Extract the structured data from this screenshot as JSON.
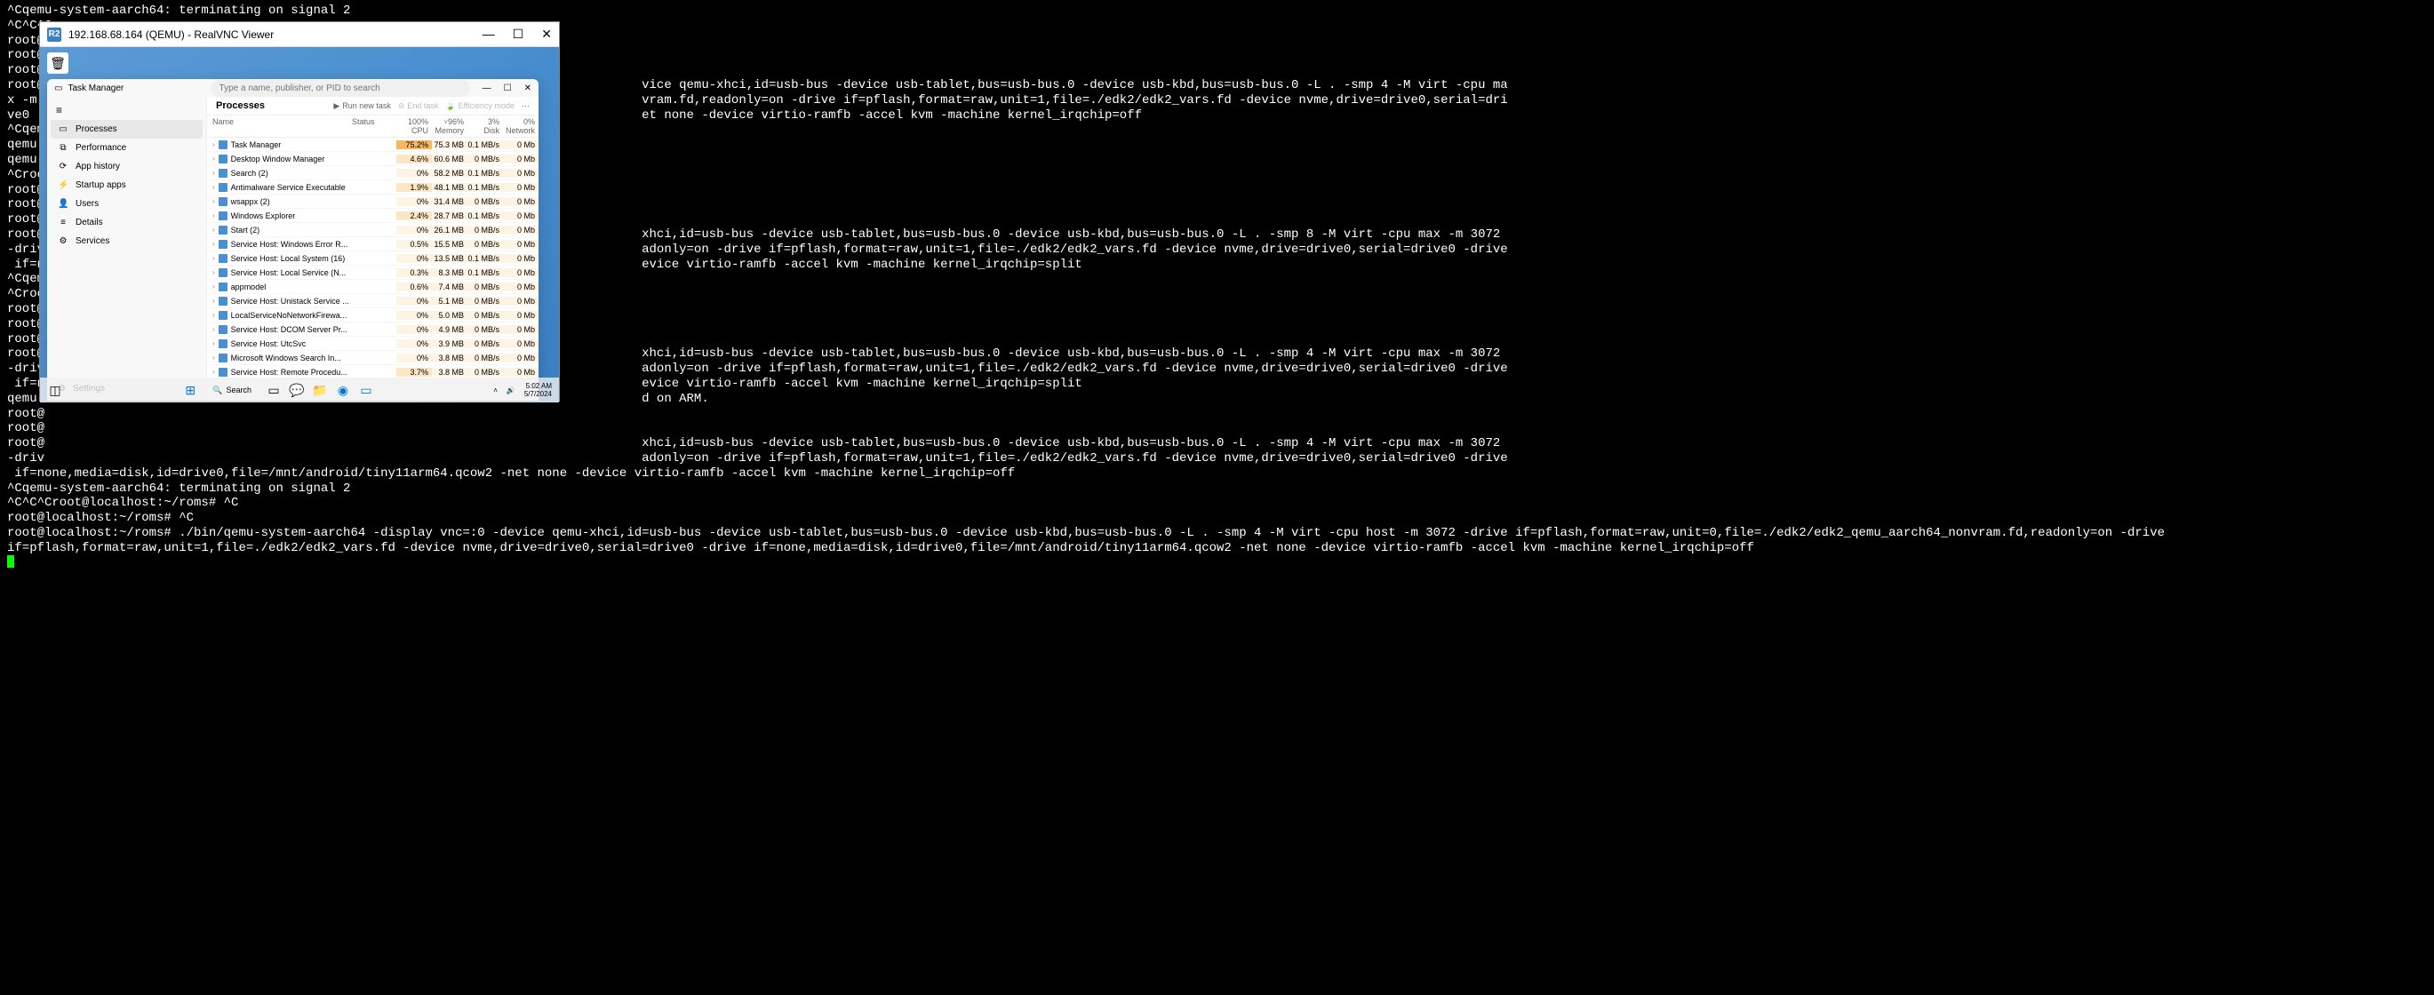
{
  "terminal_lines": [
    "^Cqemu-system-aarch64: terminating on signal 2",
    "^C^C^C",
    "root@",
    "root@",
    "root@",
    "root@                                                                                vice qemu-xhci,id=usb-bus -device usb-tablet,bus=usb-bus.0 -device usb-kbd,bus=usb-bus.0 -L . -smp 4 -M virt -cpu ma",
    "x -m                                                                                 vram.fd,readonly=on -drive if=pflash,format=raw,unit=1,file=./edk2/edk2_vars.fd -device nvme,drive=drive0,serial=dri",
    "ve0 -                                                                                et none -device virtio-ramfb -accel kvm -machine kernel_irqchip=off",
    "^Cqemu",
    "qemu-",
    "qemu-",
    "^Croot@",
    "root@",
    "root@",
    "root@",
    "root@                                                                                xhci,id=usb-bus -device usb-tablet,bus=usb-bus.0 -device usb-kbd,bus=usb-bus.0 -L . -smp 8 -M virt -cpu max -m 3072",
    "-driv                                                                                adonly=on -drive if=pflash,format=raw,unit=1,file=./edk2/edk2_vars.fd -device nvme,drive=drive0,serial=drive0 -drive",
    " if=n                                                                                evice virtio-ramfb -accel kvm -machine kernel_irqchip=split",
    "^Cqemu",
    "^Croot@",
    "root@",
    "root@",
    "root@",
    "root@                                                                                xhci,id=usb-bus -device usb-tablet,bus=usb-bus.0 -device usb-kbd,bus=usb-bus.0 -L . -smp 4 -M virt -cpu max -m 3072",
    "-driv                                                                                adonly=on -drive if=pflash,format=raw,unit=1,file=./edk2/edk2_vars.fd -device nvme,drive=drive0,serial=drive0 -drive",
    " if=n                                                                                evice virtio-ramfb -accel kvm -machine kernel_irqchip=split",
    "qemu-                                                                                d on ARM.",
    "root@",
    "root@",
    "root@                                                                                xhci,id=usb-bus -device usb-tablet,bus=usb-bus.0 -device usb-kbd,bus=usb-bus.0 -L . -smp 4 -M virt -cpu max -m 3072",
    "-driv                                                                                adonly=on -drive if=pflash,format=raw,unit=1,file=./edk2/edk2_vars.fd -device nvme,drive=drive0,serial=drive0 -drive",
    " if=none,media=disk,id=drive0,file=/mnt/android/tiny11arm64.qcow2 -net none -device virtio-ramfb -accel kvm -machine kernel_irqchip=off",
    "^Cqemu-system-aarch64: terminating on signal 2",
    "^C^C^Croot@localhost:~/roms# ^C",
    "root@localhost:~/roms# ^C",
    "root@localhost:~/roms# ./bin/qemu-system-aarch64 -display vnc=:0 -device qemu-xhci,id=usb-bus -device usb-tablet,bus=usb-bus.0 -device usb-kbd,bus=usb-bus.0 -L . -smp 4 -M virt -cpu host -m 3072 -drive if=pflash,format=raw,unit=0,file=./edk2/edk2_qemu_aarch64_nonvram.fd,readonly=on -drive if=pflash,format=raw,unit=1,file=./edk2/edk2_vars.fd -device nvme,drive=drive0,serial=drive0 -drive if=none,media=disk,id=drive0,file=/mnt/android/tiny11arm64.qcow2 -net none -device virtio-ramfb -accel kvm -machine kernel_irqchip=off"
  ],
  "vnc": {
    "icon_text": "R2",
    "title": "192.168.68.164 (QEMU) - RealVNC Viewer",
    "minimize": "—",
    "maximize": "☐",
    "close": "✕"
  },
  "taskmgr": {
    "title": "Task Manager",
    "search_placeholder": "Type a name, publisher, or PID to search",
    "nav": [
      {
        "icon": "▭",
        "label": "Processes"
      },
      {
        "icon": "⧉",
        "label": "Performance"
      },
      {
        "icon": "⟳",
        "label": "App history"
      },
      {
        "icon": "⚡",
        "label": "Startup apps"
      },
      {
        "icon": "👤",
        "label": "Users"
      },
      {
        "icon": "≡",
        "label": "Details"
      },
      {
        "icon": "⚙",
        "label": "Services"
      }
    ],
    "settings": "Settings",
    "proc_header": "Processes",
    "actions": {
      "run": "Run new task",
      "end": "End task",
      "eff": "Efficiency mode"
    },
    "cols": {
      "name": "Name",
      "status": "Status",
      "cpu_pct": "100%",
      "cpu": "CPU",
      "mem_pct": "96%",
      "mem": "Memory",
      "disk_pct": "3%",
      "disk": "Disk",
      "net_pct": "0%",
      "net": "Network"
    },
    "rows": [
      {
        "name": "Task Manager",
        "cpu": "75.2%",
        "mem": "75.3 MB",
        "disk": "0.1 MB/s",
        "net": "0 Mb",
        "cpu_heat": "heat-high"
      },
      {
        "name": "Desktop Window Manager",
        "cpu": "4.6%",
        "mem": "60.6 MB",
        "disk": "0 MB/s",
        "net": "0 Mb",
        "cpu_heat": "heat-med"
      },
      {
        "name": "Search (2)",
        "cpu": "0%",
        "mem": "58.2 MB",
        "disk": "0.1 MB/s",
        "net": "0 Mb",
        "cpu_heat": "heat-low"
      },
      {
        "name": "Antimalware Service Executable",
        "cpu": "1.9%",
        "mem": "48.1 MB",
        "disk": "0.1 MB/s",
        "net": "0 Mb",
        "cpu_heat": "heat-med"
      },
      {
        "name": "wsappx (2)",
        "cpu": "0%",
        "mem": "31.4 MB",
        "disk": "0 MB/s",
        "net": "0 Mb",
        "cpu_heat": "heat-low"
      },
      {
        "name": "Windows Explorer",
        "cpu": "2.4%",
        "mem": "28.7 MB",
        "disk": "0.1 MB/s",
        "net": "0 Mb",
        "cpu_heat": "heat-med"
      },
      {
        "name": "Start (2)",
        "cpu": "0%",
        "mem": "26.1 MB",
        "disk": "0 MB/s",
        "net": "0 Mb",
        "cpu_heat": "heat-low"
      },
      {
        "name": "Service Host: Windows Error R...",
        "cpu": "0.5%",
        "mem": "15.5 MB",
        "disk": "0 MB/s",
        "net": "0 Mb",
        "cpu_heat": "heat-low"
      },
      {
        "name": "Service Host: Local System (16)",
        "cpu": "0%",
        "mem": "13.5 MB",
        "disk": "0.1 MB/s",
        "net": "0 Mb",
        "cpu_heat": "heat-low"
      },
      {
        "name": "Service Host: Local Service (N...",
        "cpu": "0.3%",
        "mem": "8.3 MB",
        "disk": "0.1 MB/s",
        "net": "0 Mb",
        "cpu_heat": "heat-low"
      },
      {
        "name": "appmodel",
        "cpu": "0.6%",
        "mem": "7.4 MB",
        "disk": "0 MB/s",
        "net": "0 Mb",
        "cpu_heat": "heat-low"
      },
      {
        "name": "Service Host: Unistack Service ...",
        "cpu": "0%",
        "mem": "5.1 MB",
        "disk": "0 MB/s",
        "net": "0 Mb",
        "cpu_heat": "heat-low"
      },
      {
        "name": "LocalServiceNoNetworkFirewa...",
        "cpu": "0%",
        "mem": "5.0 MB",
        "disk": "0 MB/s",
        "net": "0 Mb",
        "cpu_heat": "heat-low"
      },
      {
        "name": "Service Host: DCOM Server Pr...",
        "cpu": "0%",
        "mem": "4.9 MB",
        "disk": "0 MB/s",
        "net": "0 Mb",
        "cpu_heat": "heat-low"
      },
      {
        "name": "Service Host: UtcSvc",
        "cpu": "0%",
        "mem": "3.9 MB",
        "disk": "0 MB/s",
        "net": "0 Mb",
        "cpu_heat": "heat-low"
      },
      {
        "name": "Microsoft Windows Search In...",
        "cpu": "0%",
        "mem": "3.8 MB",
        "disk": "0 MB/s",
        "net": "0 Mb",
        "cpu_heat": "heat-low"
      },
      {
        "name": "Service Host: Remote Procedu...",
        "cpu": "3.7%",
        "mem": "3.8 MB",
        "disk": "0 MB/s",
        "net": "0 Mb",
        "cpu_heat": "heat-med"
      }
    ]
  },
  "taskbar": {
    "search": "Search",
    "time": "5:02 AM",
    "date": "5/7/2024"
  }
}
